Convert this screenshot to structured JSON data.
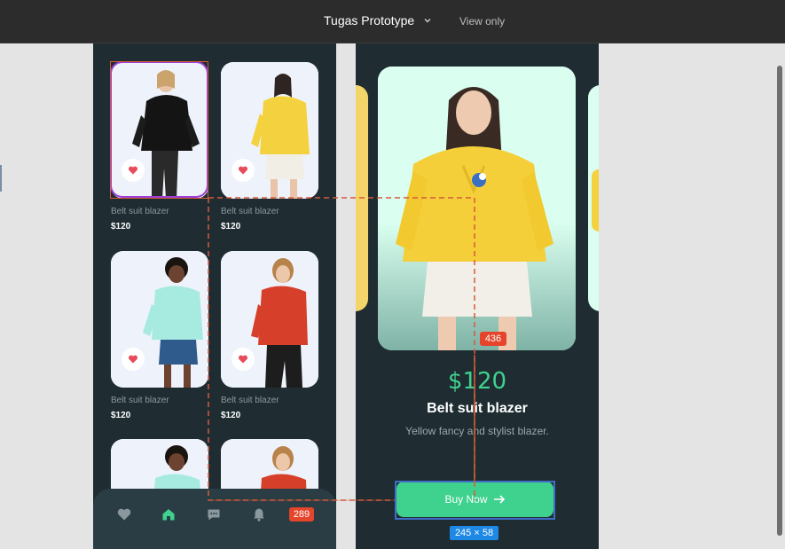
{
  "topbar": {
    "title": "Tugas Prototype",
    "view_mode": "View only"
  },
  "products": [
    {
      "name": "Belt suit blazer",
      "price": "$120",
      "outfit": "black-puffer"
    },
    {
      "name": "Belt suit blazer",
      "price": "$120",
      "outfit": "yellow-hoodie"
    },
    {
      "name": "Belt suit blazer",
      "price": "$120",
      "outfit": "mint-hoodie"
    },
    {
      "name": "Belt suit blazer",
      "price": "$120",
      "outfit": "red-hoodie"
    },
    {
      "name": "",
      "price": "",
      "outfit": "mint-hoodie"
    },
    {
      "name": "",
      "price": "",
      "outfit": "red-hoodie"
    }
  ],
  "bottom_nav": {
    "items": [
      "heart-icon",
      "home-icon",
      "chat-icon",
      "bell-icon"
    ],
    "active": "home-icon",
    "hotspot_badge": "289"
  },
  "detail": {
    "price": "$120",
    "name": "Belt suit blazer",
    "description": "Yellow fancy and stylist blazer.",
    "image_hotspot_badge": "436",
    "buy_label": "Buy Now"
  },
  "selection": {
    "dimensions": "245 × 58"
  },
  "colors": {
    "phone_bg": "#1f2d33",
    "accent_green": "#3fd28e",
    "hotspot_red": "#e4452b",
    "selection_blue": "#1e88e5",
    "selected_purple": "#9b3fd6"
  }
}
